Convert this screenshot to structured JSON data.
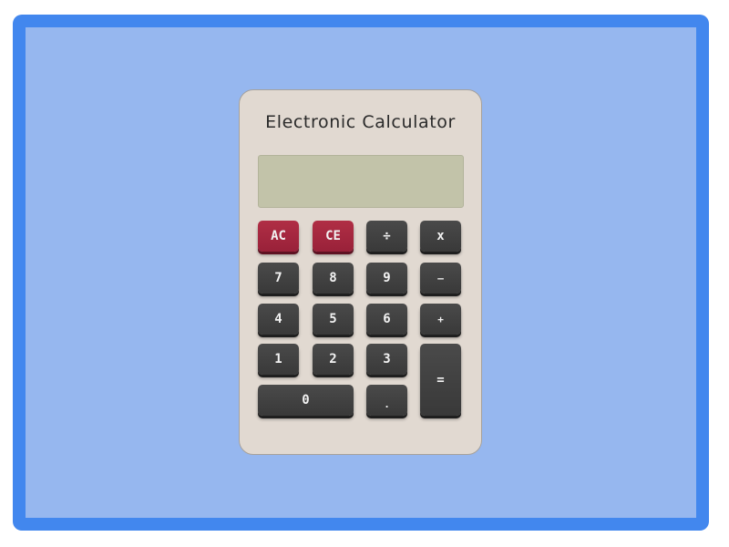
{
  "calculator": {
    "title": "Electronic Calculator",
    "display": "",
    "keys": {
      "ac": "AC",
      "ce": "CE",
      "divide": "÷",
      "multiply": "x",
      "seven": "7",
      "eight": "8",
      "nine": "9",
      "minus": "–",
      "four": "4",
      "five": "5",
      "six": "6",
      "plus": "+",
      "one": "1",
      "two": "2",
      "three": "3",
      "equals": "=",
      "zero": "0",
      "decimal": "."
    }
  },
  "colors": {
    "frame_border": "#4287ee",
    "frame_background": "#96b7ef",
    "calculator_body": "#e1d9d1",
    "display_background": "#c2c3a9",
    "key_dark": "#404040",
    "key_red": "#a32840"
  }
}
